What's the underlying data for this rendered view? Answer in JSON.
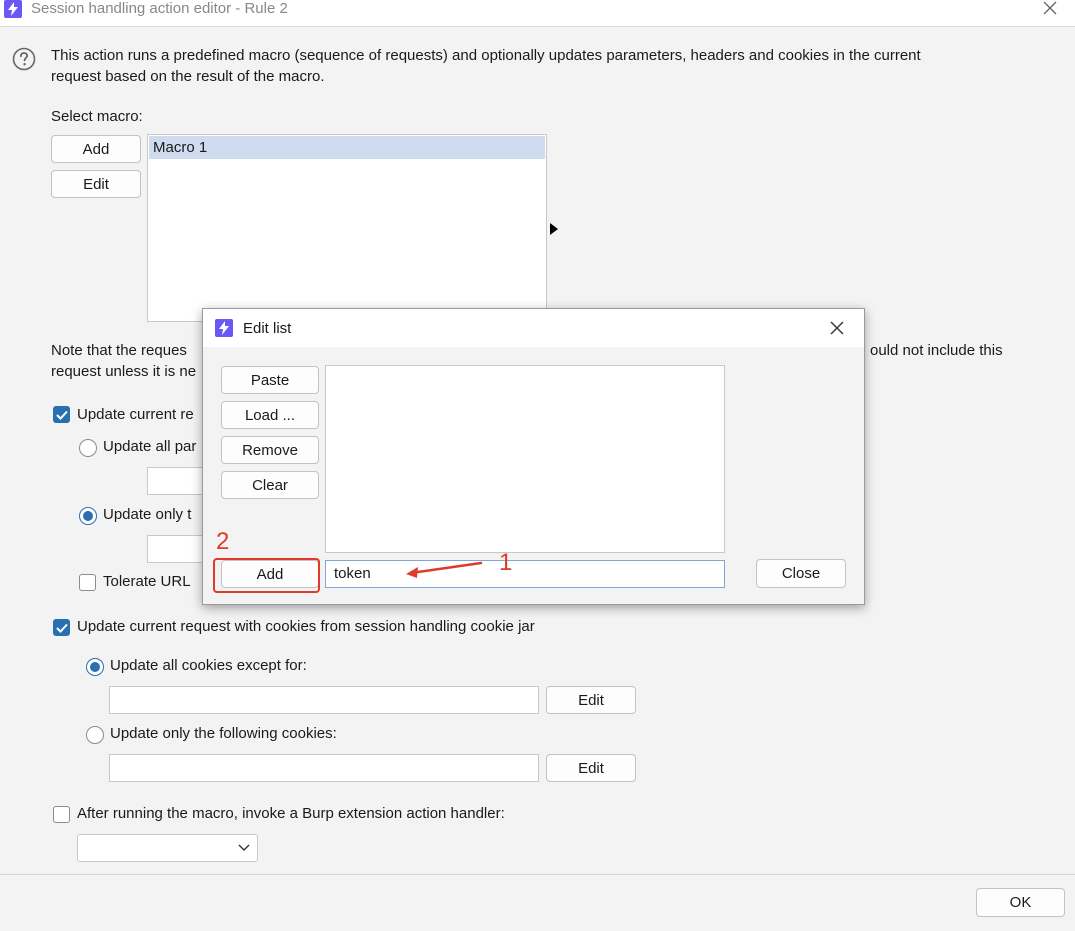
{
  "window": {
    "title": "Session handling action editor - Rule 2"
  },
  "description": {
    "line1": "This action runs a predefined macro (sequence of requests) and optionally updates parameters, headers and cookies in the current",
    "line2": "request based on the result of the macro."
  },
  "macro": {
    "select_label": "Select macro:",
    "add_label": "Add",
    "edit_label": "Edit",
    "items": [
      "Macro 1"
    ]
  },
  "note": {
    "line1_left": "Note that the reques",
    "line1_right": "ould not include this",
    "line2_left": "request unless it is ne"
  },
  "params": {
    "update_current_label": "Update current re",
    "update_all_label": "Update all par",
    "update_only_label": "Update only t",
    "tolerate_label": "Tolerate URL "
  },
  "cookies": {
    "update_label": "Update current request with cookies from session handling cookie jar",
    "all_except_label": "Update all cookies except for:",
    "only_following_label": "Update only the following cookies:",
    "edit_label": "Edit"
  },
  "extension": {
    "label": "After running the macro, invoke a Burp extension action handler:"
  },
  "ok_label": "OK",
  "edit_list_dialog": {
    "title": "Edit list",
    "paste_label": "Paste",
    "load_label": "Load ...",
    "remove_label": "Remove",
    "clear_label": "Clear",
    "add_label": "Add",
    "close_label": "Close",
    "input_value": "token"
  },
  "annotations": {
    "one": "1",
    "two": "2"
  },
  "colors": {
    "accent": "#2a6fb0",
    "annotation_red": "#e03a2b",
    "app_icon": "#6b57f5"
  }
}
